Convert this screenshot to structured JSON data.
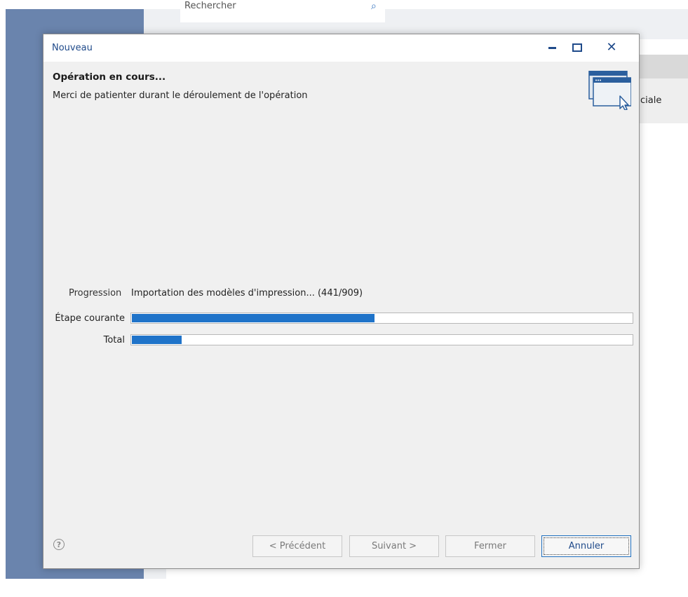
{
  "background": {
    "search_placeholder": "Rechercher",
    "partial_tile_label": "ciale"
  },
  "dialog": {
    "title": "Nouveau",
    "heading": "Opération en cours...",
    "subheading": "Merci de patienter durant le déroulement de l'opération",
    "progress_label": "Progression",
    "progress_text": "Importation des modèles d'impression... (441/909)",
    "current_step_label": "Étape courante",
    "total_label": "Total",
    "current_step_progress": 0.485,
    "total_progress": 0.1,
    "buttons": {
      "previous": "< Précédent",
      "next": "Suivant >",
      "close": "Fermer",
      "cancel": "Annuler"
    }
  },
  "icons": {
    "search": "search-icon",
    "minimize": "minimize-icon",
    "maximize": "maximize-icon",
    "close": "close-icon",
    "wizard": "window-cursor-icon",
    "help": "help-icon"
  },
  "colors": {
    "accent": "#1f73c9",
    "title_text": "#1f4a8a",
    "sidebar": "#6a84ad"
  }
}
